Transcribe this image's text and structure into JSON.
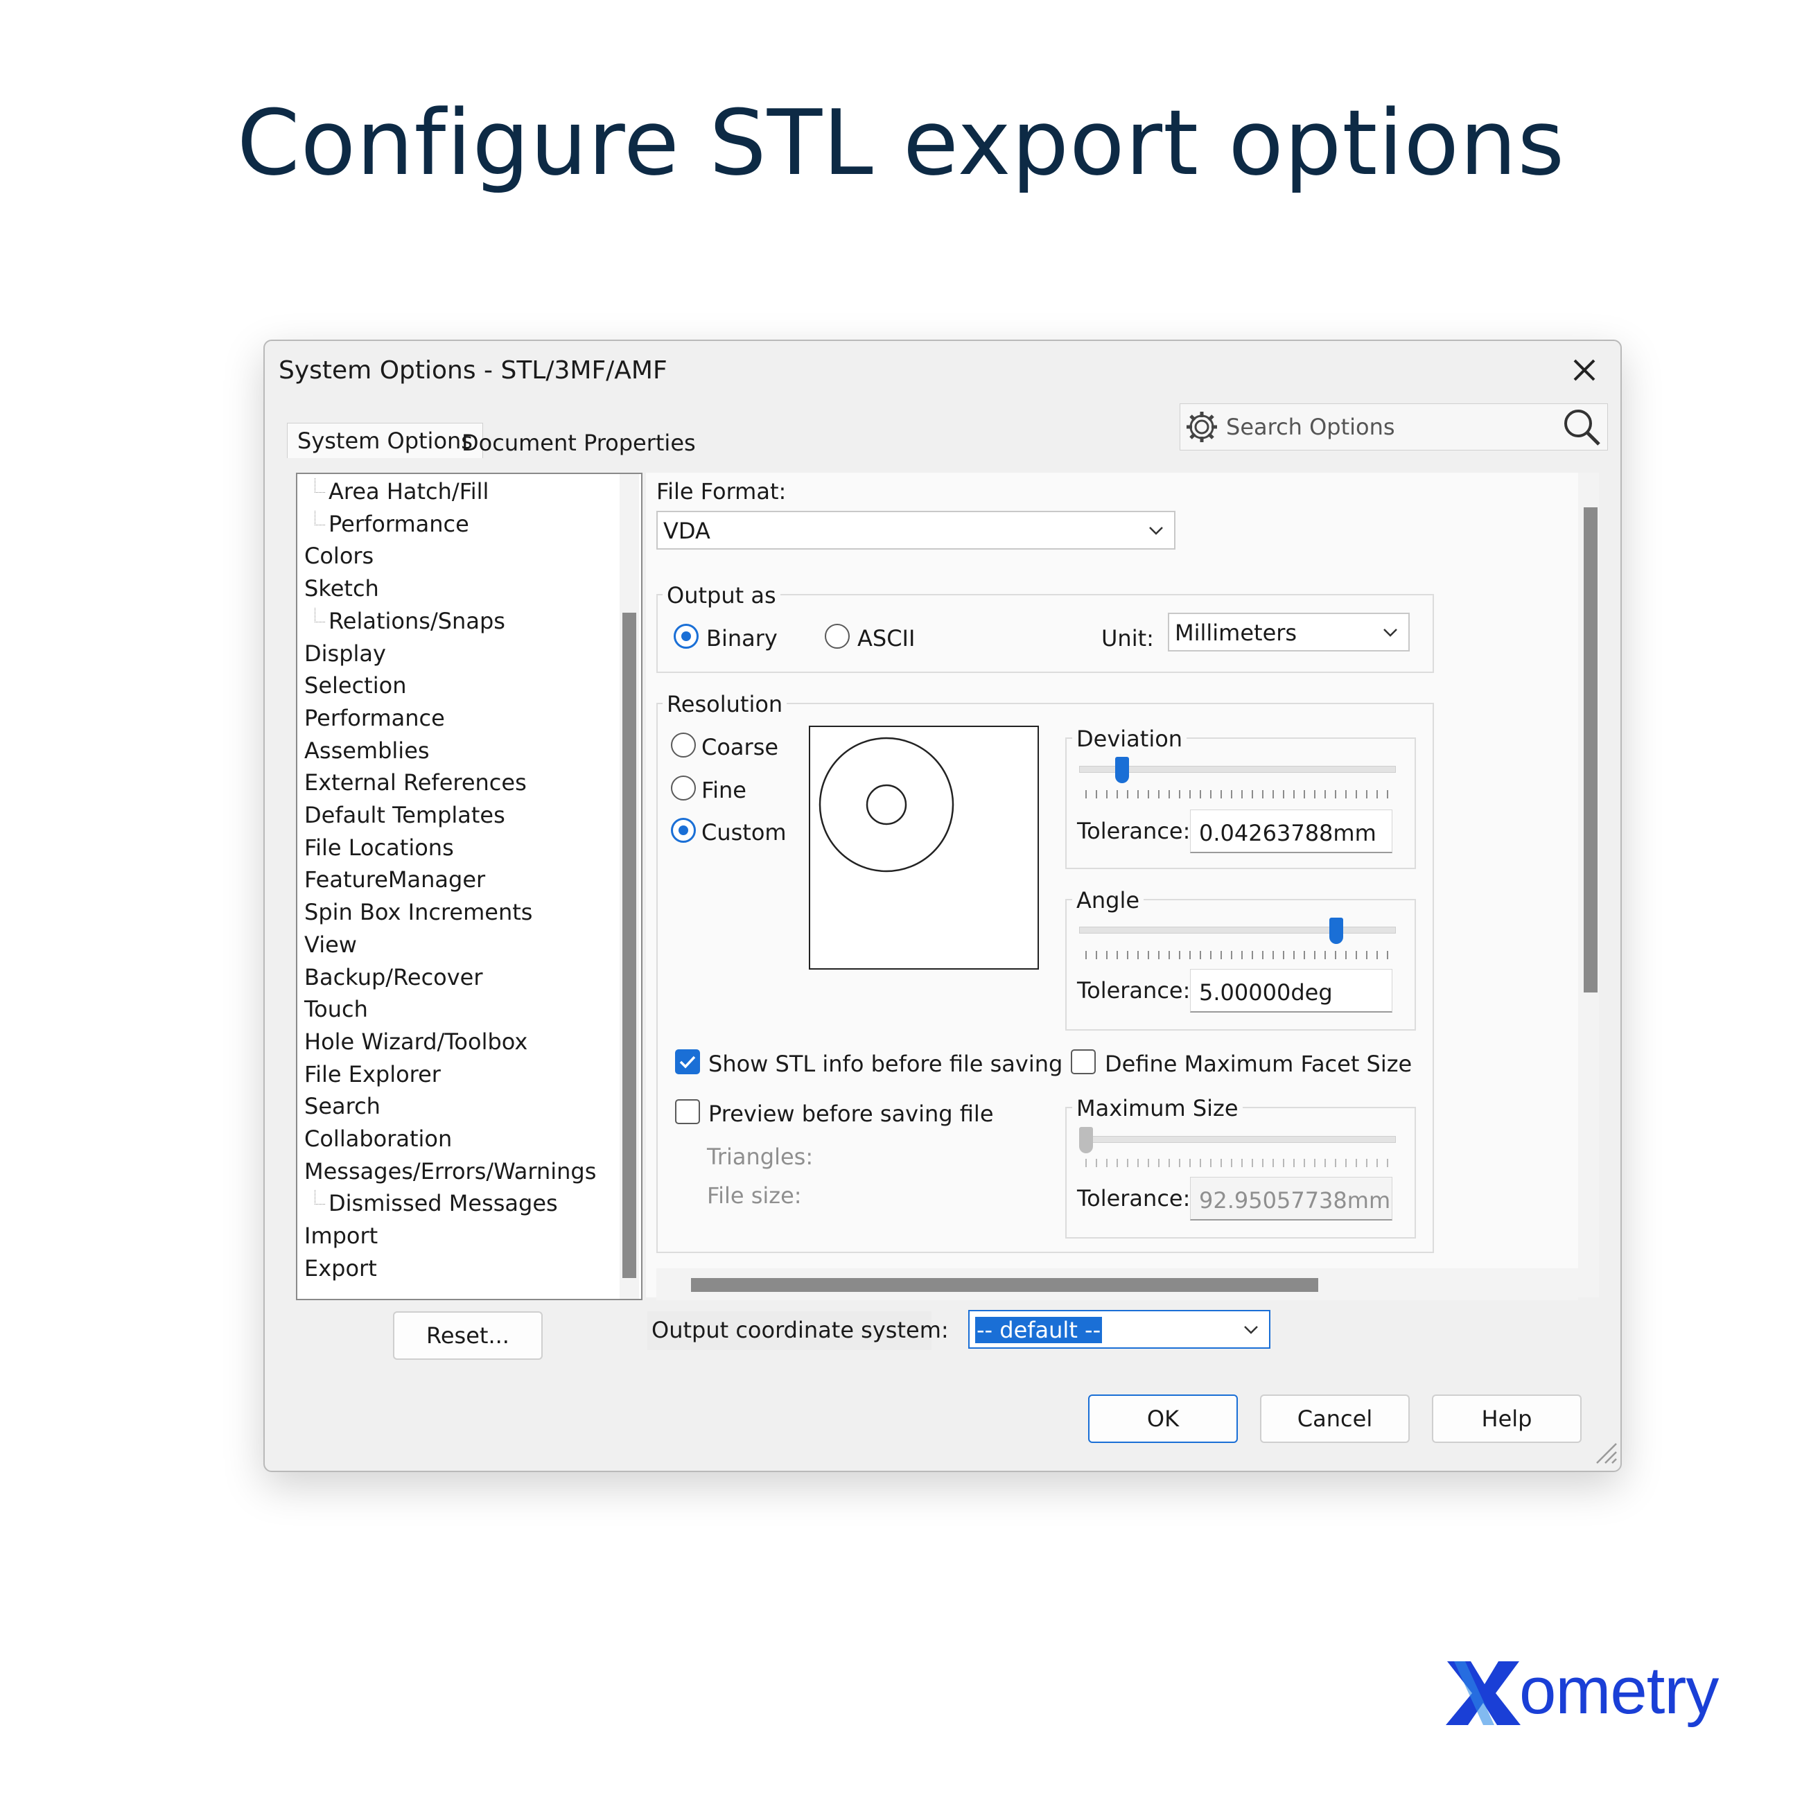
{
  "page": {
    "title": "Configure STL export options"
  },
  "dialog": {
    "title": "System Options - STL/3MF/AMF",
    "tabs": [
      "System Options",
      "Document Properties"
    ],
    "search_placeholder": "Search Options"
  },
  "tree": {
    "items": [
      {
        "label": "Area Hatch/Fill",
        "indent": 1
      },
      {
        "label": "Performance",
        "indent": 1
      },
      {
        "label": "Colors",
        "indent": 0
      },
      {
        "label": "Sketch",
        "indent": 0
      },
      {
        "label": "Relations/Snaps",
        "indent": 1
      },
      {
        "label": "Display",
        "indent": 0
      },
      {
        "label": "Selection",
        "indent": 0
      },
      {
        "label": "Performance",
        "indent": 0
      },
      {
        "label": "Assemblies",
        "indent": 0
      },
      {
        "label": "External References",
        "indent": 0
      },
      {
        "label": "Default Templates",
        "indent": 0
      },
      {
        "label": "File Locations",
        "indent": 0
      },
      {
        "label": "FeatureManager",
        "indent": 0
      },
      {
        "label": "Spin Box Increments",
        "indent": 0
      },
      {
        "label": "View",
        "indent": 0
      },
      {
        "label": "Backup/Recover",
        "indent": 0
      },
      {
        "label": "Touch",
        "indent": 0
      },
      {
        "label": "Hole Wizard/Toolbox",
        "indent": 0
      },
      {
        "label": "File Explorer",
        "indent": 0
      },
      {
        "label": "Search",
        "indent": 0
      },
      {
        "label": "Collaboration",
        "indent": 0
      },
      {
        "label": "Messages/Errors/Warnings",
        "indent": 0
      },
      {
        "label": "Dismissed Messages",
        "indent": 1
      },
      {
        "label": "Import",
        "indent": 0
      },
      {
        "label": "Export",
        "indent": 0
      }
    ]
  },
  "file_format": {
    "label": "File Format:",
    "value": "VDA"
  },
  "output_as": {
    "label": "Output as",
    "binary": "Binary",
    "ascii": "ASCII",
    "selected": "Binary",
    "unit_label": "Unit:",
    "unit_value": "Millimeters"
  },
  "resolution": {
    "label": "Resolution",
    "coarse": "Coarse",
    "fine": "Fine",
    "custom": "Custom",
    "selected": "Custom",
    "deviation": {
      "label": "Deviation",
      "tolerance_label": "Tolerance:",
      "tolerance_value": "0.04263788mm",
      "slider_level": 0.12
    },
    "angle": {
      "label": "Angle",
      "tolerance_label": "Tolerance:",
      "tolerance_value": "5.00000deg",
      "slider_level": 0.83
    }
  },
  "options": {
    "show_stl_info": {
      "label": "Show STL info before file saving",
      "checked": true
    },
    "preview": {
      "label": "Preview before saving file",
      "checked": false
    },
    "triangles_label": "Triangles:",
    "file_size_label": "File size:",
    "define_max_facet": {
      "label": "Define Maximum Facet Size",
      "checked": false
    },
    "max_size": {
      "label": "Maximum Size",
      "tolerance_label": "Tolerance:",
      "tolerance_value": "92.95057738mm",
      "slider_level": 0.0
    }
  },
  "output_coordinate": {
    "label": "Output coordinate system:",
    "value": "-- default --"
  },
  "buttons": {
    "reset": "Reset...",
    "ok": "OK",
    "cancel": "Cancel",
    "help": "Help"
  },
  "brand": {
    "logo_text": "Xometry",
    "color": "#1a3fd6"
  },
  "colors": {
    "accent": "#1a6fd6",
    "title": "#0d2a45"
  }
}
